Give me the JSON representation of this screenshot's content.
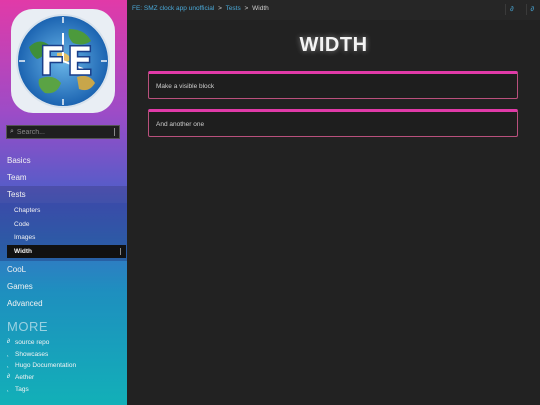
{
  "sidebar": {
    "logo_letters": "FE",
    "search": {
      "placeholder": "Search..."
    },
    "nav": [
      {
        "label": "Basics"
      },
      {
        "label": "Team"
      },
      {
        "label": "Tests"
      }
    ],
    "tests_children": [
      {
        "label": "Chapters"
      },
      {
        "label": "Code"
      },
      {
        "label": "Images"
      },
      {
        "label": "Width",
        "active": true
      }
    ],
    "nav_after": [
      {
        "label": "CooL"
      },
      {
        "label": "Games"
      },
      {
        "label": "Advanced"
      }
    ],
    "more_heading": "MORE",
    "more_items": [
      {
        "icon": "link-icon",
        "label": "source repo"
      },
      {
        "icon": "bolt-icon",
        "label": "Showcases"
      },
      {
        "icon": "bolt-icon",
        "label": "Hugo Documentation"
      },
      {
        "icon": "link-icon",
        "label": "Aether"
      },
      {
        "icon": "bolt-icon",
        "label": "Tags"
      }
    ]
  },
  "topbar": {
    "breadcrumb": {
      "root": "FE: SMZ clock app unofficial",
      "sep1": ">",
      "section": "Tests",
      "sep2": ">",
      "current": "Width"
    }
  },
  "main": {
    "title": "WIDTH",
    "blocks": [
      {
        "text": "Make a visible block"
      },
      {
        "text": "And another one"
      }
    ]
  },
  "colors": {
    "accent": "#e13aa8",
    "link": "#4aa9d8",
    "background": "#222222"
  }
}
